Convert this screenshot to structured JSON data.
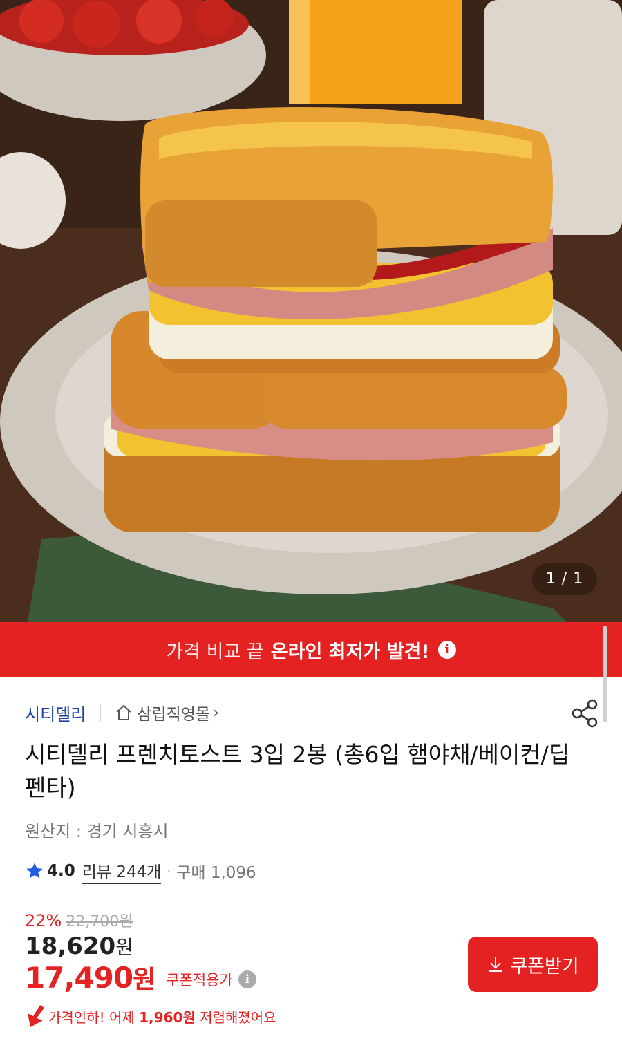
{
  "hero": {
    "counter": "1 / 1",
    "image_icon": "food-photo"
  },
  "banner": {
    "lead": "가격 비교 끝",
    "emphasis": "온라인 최저가 발견!",
    "icon": "info-icon",
    "background": "#e52222"
  },
  "seller": {
    "brand": "시티델리",
    "store": "삼립직영몰",
    "store_chevron": "›",
    "home_icon": "home-icon",
    "share_icon": "share-icon"
  },
  "product": {
    "title": "시티델리 프렌치토스트 3입 2봉 (총6입 햄야채/베이컨/딥펜타)",
    "origin": "원산지 : 경기 시흥시"
  },
  "rating": {
    "star_icon": "star-icon",
    "score": "4.0",
    "reviews": "리뷰 244개",
    "separator": "·",
    "purchases": "구매 1,096"
  },
  "price": {
    "discount_rate": "22%",
    "original_price": "22,700원",
    "sale_price": "18,620",
    "sale_unit": "원",
    "coupon_price": "17,490",
    "coupon_unit": "원",
    "coupon_note": "쿠폰적용가",
    "coupon_info_icon": "info-icon",
    "accent_color": "#e52222"
  },
  "coupon_button": {
    "label": "쿠폰받기",
    "icon": "download-icon"
  },
  "price_drop": {
    "icon": "arrow-down-icon",
    "prefix": "가격인하! 어제 ",
    "amount": "1,960원",
    "suffix": " 저렴해졌어요"
  }
}
